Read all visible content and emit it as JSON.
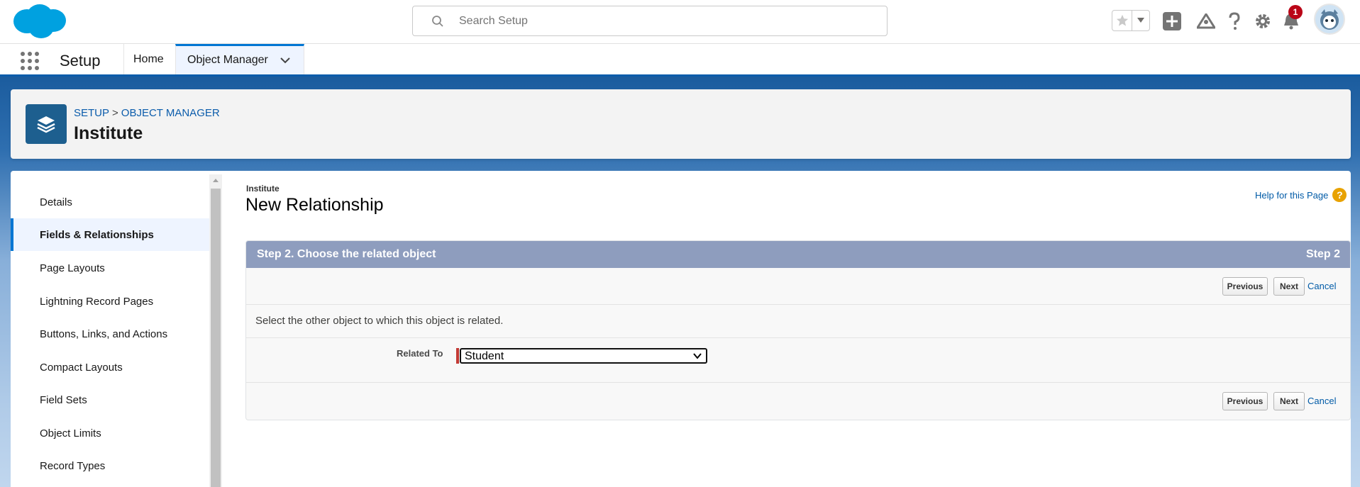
{
  "header": {
    "search_placeholder": "Search Setup",
    "notification_count": "1"
  },
  "nav": {
    "app_name": "Setup",
    "tabs": [
      {
        "label": "Home"
      },
      {
        "label": "Object Manager"
      }
    ]
  },
  "object_header": {
    "breadcrumb": [
      "SETUP",
      ">",
      "OBJECT MANAGER"
    ],
    "title": "Institute"
  },
  "sidebar": {
    "items": [
      {
        "label": "Details"
      },
      {
        "label": "Fields & Relationships"
      },
      {
        "label": "Page Layouts"
      },
      {
        "label": "Lightning Record Pages"
      },
      {
        "label": "Buttons, Links, and Actions"
      },
      {
        "label": "Compact Layouts"
      },
      {
        "label": "Field Sets"
      },
      {
        "label": "Object Limits"
      },
      {
        "label": "Record Types"
      }
    ]
  },
  "page": {
    "object_label": "Institute",
    "title": "New Relationship",
    "help_link": "Help for this Page",
    "step_title": "Step 2. Choose the related object",
    "step_indicator": "Step 2",
    "buttons": {
      "previous": "Previous",
      "next": "Next",
      "cancel": "Cancel"
    },
    "instruction": "Select the other object to which this object is related.",
    "field_label": "Related To",
    "field_value": "Student"
  },
  "colors": {
    "brand_blue": "#0176d3",
    "step_header": "#8e9dbe",
    "required": "#c23934",
    "badge": "#ba0517"
  }
}
